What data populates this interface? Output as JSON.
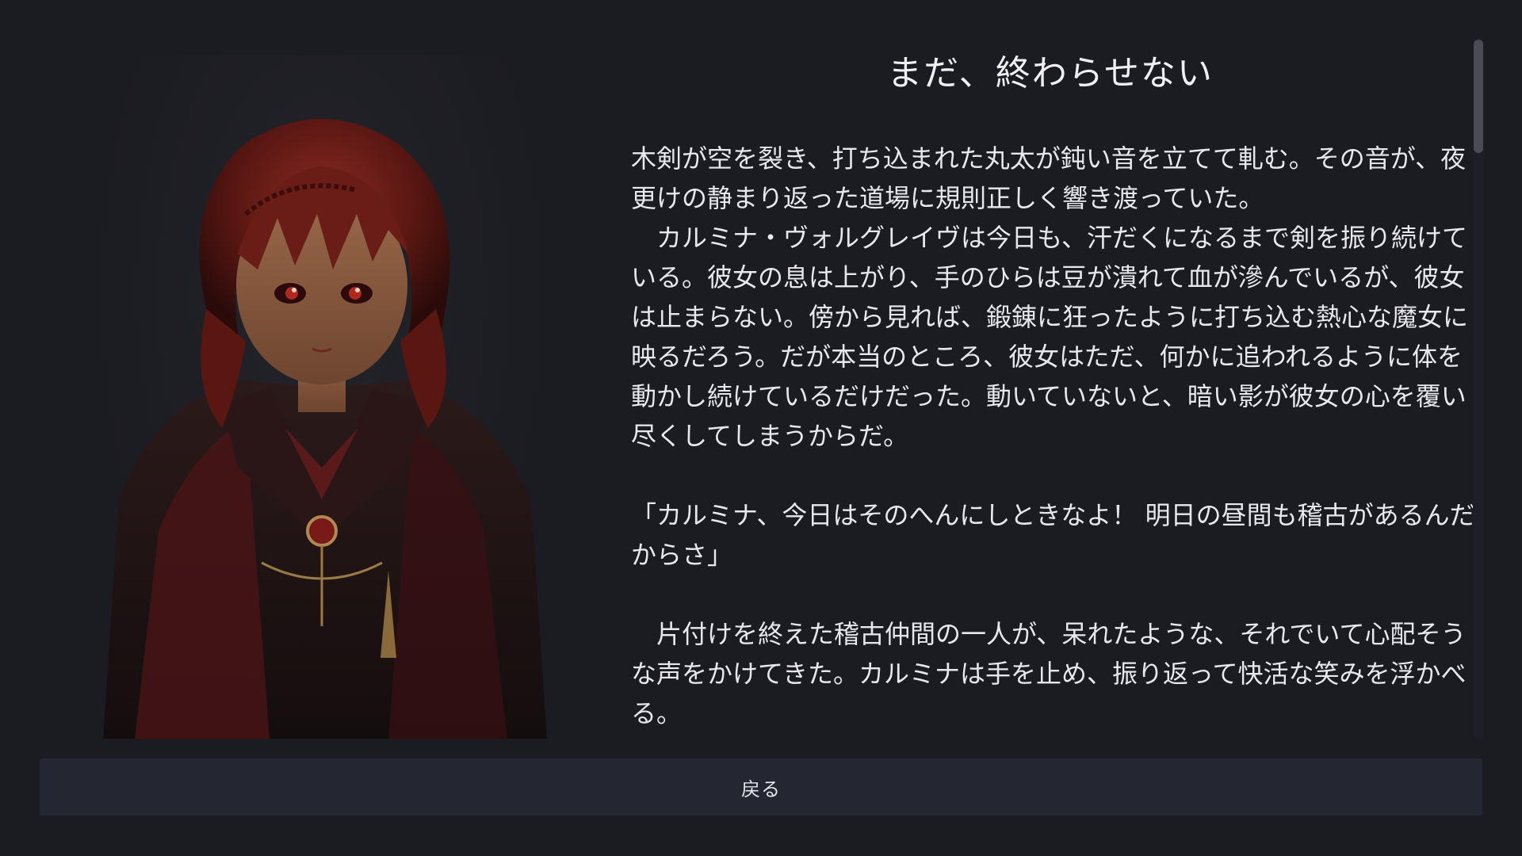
{
  "story": {
    "title": "まだ、終わらせない",
    "paragraphs": [
      "木剣が空を裂き、打ち込まれた丸太が鈍い音を立てて軋む。その音が、夜更けの静まり返った道場に規則正しく響き渡っていた。",
      "　カルミナ・ヴォルグレイヴは今日も、汗だくになるまで剣を振り続けている。彼女の息は上がり、手のひらは豆が潰れて血が滲んでいるが、彼女は止まらない。傍から見れば、鍛錬に狂ったように打ち込む熱心な魔女に映るだろう。だが本当のところ、彼女はただ、何かに追われるように体を動かし続けているだけだった。動いていないと、暗い影が彼女の心を覆い尽くしてしまうからだ。",
      "「カルミナ、今日はそのへんにしときなよ！ 明日の昼間も稽古があるんだからさ」",
      "　片付けを終えた稽古仲間の一人が、呆れたような、それでいて心配そうな声をかけてきた。カルミナは手を止め、振り返って快活な笑みを浮かべる。"
    ]
  },
  "back_button": {
    "label": "戻る"
  },
  "colors": {
    "background": "#1b1c22",
    "button_bg": "#242631",
    "text": "#e8e8ec",
    "scroll_thumb": "#4a4b53"
  }
}
